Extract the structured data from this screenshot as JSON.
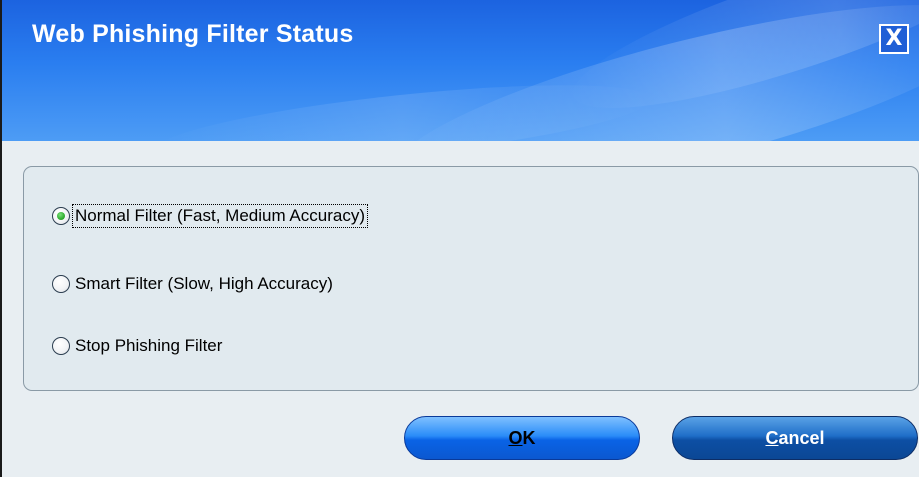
{
  "dialog": {
    "title": "Web Phishing Filter Status",
    "close_symbol": "X"
  },
  "options": [
    {
      "label": "Normal Filter (Fast, Medium Accuracy)",
      "checked": true
    },
    {
      "label": "Smart Filter (Slow, High Accuracy)",
      "checked": false
    },
    {
      "label": "Stop Phishing Filter",
      "checked": false
    }
  ],
  "buttons": {
    "ok": {
      "mnemonic": "O",
      "rest": "K"
    },
    "cancel": {
      "mnemonic": "C",
      "rest": "ancel"
    }
  },
  "colors": {
    "banner_blue": "#2a7ef0",
    "panel_background": "#e1eaef",
    "ok_button": "#2a8cf8",
    "cancel_button": "#1f6ec8",
    "selected_radio": "#2fae2f"
  },
  "icons": {
    "close": "close-icon"
  }
}
